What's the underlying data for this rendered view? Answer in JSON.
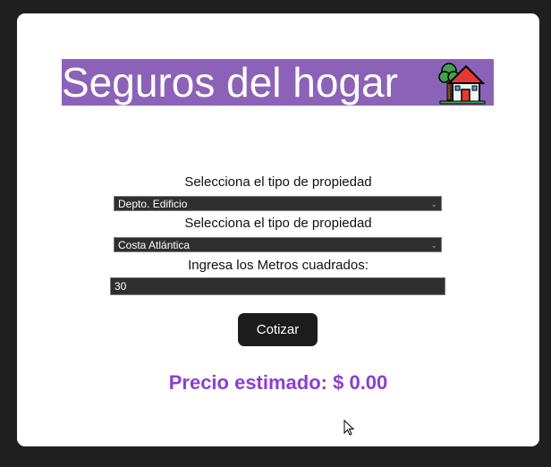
{
  "header": {
    "title": "Seguros del hogar",
    "icon": "house-with-tree-icon"
  },
  "form": {
    "property_type_label": "Selecciona el tipo de propiedad",
    "property_type_value": "Depto. Edificio",
    "location_label": "Selecciona el tipo de propiedad",
    "location_value": "Costa Atlántica",
    "meters_label": "Ingresa los Metros cuadrados:",
    "meters_value": "30",
    "submit_label": "Cotizar"
  },
  "result": {
    "price_text": "Precio estimado: $ 0.00"
  },
  "colors": {
    "banner": "#8c62b8",
    "price": "#8c3fd0",
    "button": "#1c1c1c",
    "background": "#1f1f1f"
  }
}
